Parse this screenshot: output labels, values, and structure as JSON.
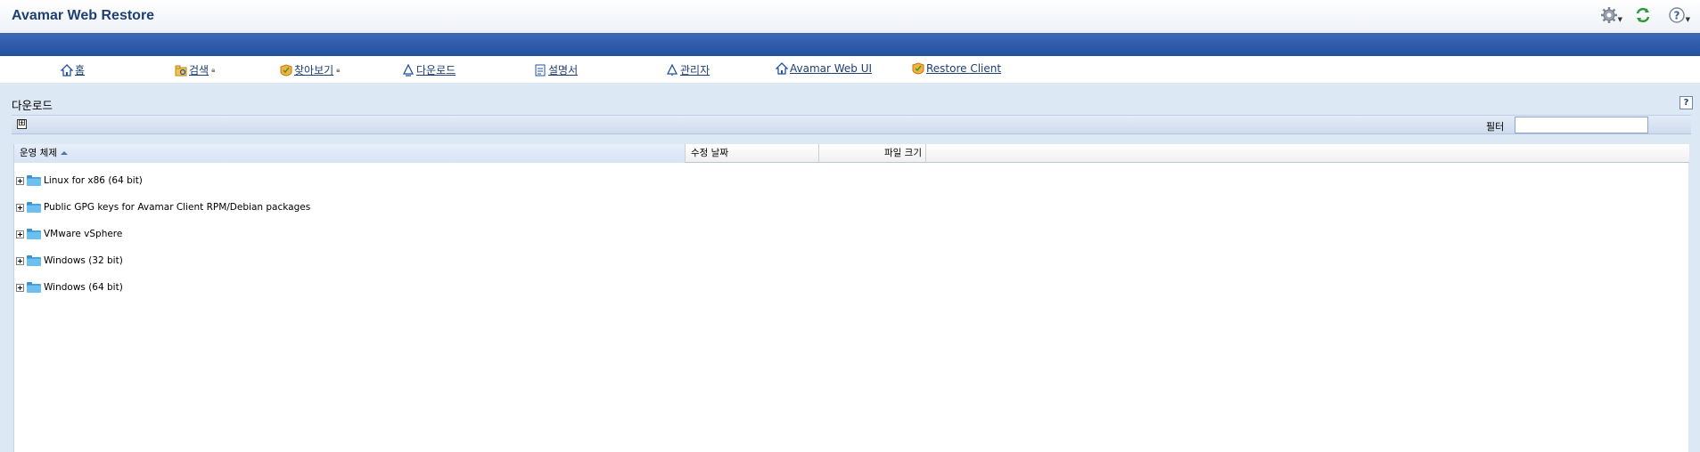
{
  "app": {
    "title": "Avamar Web Restore"
  },
  "top_icons": [
    "gear-icon",
    "refresh-icon",
    "help-icon"
  ],
  "nav": [
    {
      "label": "홈",
      "icon": "home-icon",
      "locked": false
    },
    {
      "label": "검색",
      "icon": "search-folder-icon",
      "locked": true
    },
    {
      "label": "찾아보기",
      "icon": "browse-icon",
      "locked": true
    },
    {
      "label": "다운로드",
      "icon": "download-icon",
      "locked": false
    },
    {
      "label": "설명서",
      "icon": "documentation-icon",
      "locked": false
    },
    {
      "label": "관리자",
      "icon": "admin-icon",
      "locked": false
    },
    {
      "label": "Avamar Web UI",
      "icon": "home-icon",
      "locked": false
    },
    {
      "label": "Restore Client",
      "icon": "restore-client-icon",
      "locked": false
    }
  ],
  "page": {
    "title": "다운로드",
    "help": "?"
  },
  "toolbar": {
    "expand_all": "⊞",
    "filter_label": "필터",
    "filter_value": "",
    "filter_placeholder": ""
  },
  "grid": {
    "columns": [
      {
        "label": "운영 체제",
        "sorted": "asc"
      },
      {
        "label": "수정 날짜"
      },
      {
        "label": "파일 크기"
      }
    ],
    "rows": [
      {
        "label": "Linux for x86 (64 bit)"
      },
      {
        "label": "Public GPG keys for Avamar Client RPM/Debian packages"
      },
      {
        "label": "VMware vSphere"
      },
      {
        "label": "Windows (32 bit)"
      },
      {
        "label": "Windows (64 bit)"
      }
    ]
  },
  "colors": {
    "accent": "#2351a0",
    "title": "#1e3f73",
    "content_bg": "#dde8f5",
    "folder": "#4aa3df"
  }
}
